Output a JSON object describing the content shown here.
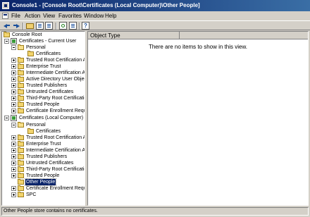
{
  "window": {
    "title": "Console1 - [Console Root\\Certificates (Local Computer)\\Other People]"
  },
  "menu": [
    "File",
    "Action",
    "View",
    "Favorites",
    "Window",
    "Help"
  ],
  "toolbar": {
    "buttons": [
      "back-icon",
      "forward-icon",
      "up-folder-icon",
      "show-hide-tree-icon",
      "properties-icon",
      "refresh-icon",
      "export-list-icon",
      "help-icon"
    ]
  },
  "tree": {
    "root": "Console Root",
    "current_user": {
      "label": "Certificates - Current User",
      "personal": "Personal",
      "personal_child": "Certificates",
      "stores": [
        "Trusted Root Certification Aut",
        "Enterprise Trust",
        "Intermediate Certification Aut",
        "Active Directory User Object",
        "Trusted Publishers",
        "Untrusted Certificates",
        "Third-Party Root Certification",
        "Trusted People",
        "Certificate Enrollment Reques"
      ]
    },
    "local_computer": {
      "label": "Certificates (Local Computer)",
      "personal": "Personal",
      "personal_child": "Certificates",
      "stores": [
        "Trusted Root Certification Aut",
        "Enterprise Trust",
        "Intermediate Certification Aut",
        "Trusted Publishers",
        "Untrusted Certificates",
        "Third-Party Root Certification",
        "Trusted People",
        "Other People",
        "Certificate Enrollment Reques",
        "SPC"
      ],
      "selected": "Other People"
    }
  },
  "list": {
    "column_header": "Object Type",
    "empty_message": "There are no items to show in this view."
  },
  "status": {
    "text": "Other People store contains no certificates."
  },
  "colors": {
    "title_bar": "#0a246a",
    "selection": "#0a246a",
    "chrome": "#d4d0c8"
  }
}
